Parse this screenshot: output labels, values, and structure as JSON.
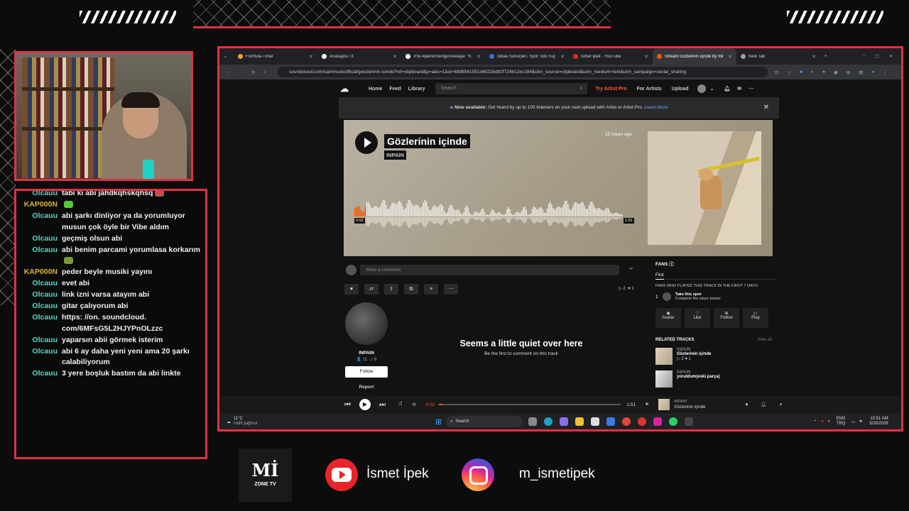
{
  "overlay": {
    "social": {
      "youtube": "İsmet İpek",
      "instagram": "m_ismetipek"
    },
    "logo": {
      "main": "Mİ",
      "sub": "ZONE TV"
    },
    "accent": "#e03145"
  },
  "chat": {
    "messages": [
      {
        "user": "Olcauu",
        "color": "#55d7c7",
        "text": "tabi ki abi jahdkqhskqhsq",
        "emote": true
      },
      {
        "user": "KAP000N",
        "color": "#66ff33",
        "text": "",
        "emote": true
      },
      {
        "user": "Olcauu",
        "color": "#55d7c7",
        "text": "abi şarkı dinliyor ya da yorumluyor musun çok öyle bir Vibe aldım",
        "emote": false
      },
      {
        "user": "Olcauu",
        "color": "#55d7c7",
        "text": "geçmiş olsun abi",
        "emote": false
      },
      {
        "user": "Olcauu",
        "color": "#55d7c7",
        "text": "abi benim parcami yorumlasa korkarım",
        "emote": true
      },
      {
        "user": "KAP000N",
        "color": "#66ff33",
        "text": "peder beyle musiki yayını",
        "emote": false
      },
      {
        "user": "Olcauu",
        "color": "#55d7c7",
        "text": "evet abi",
        "emote": false
      },
      {
        "user": "Olcauu",
        "color": "#55d7c7",
        "text": "link izni varsa atayım abi",
        "emote": false
      },
      {
        "user": "Olcauu",
        "color": "#55d7c7",
        "text": "gitar çalıyorum abi",
        "emote": false
      },
      {
        "user": "Olcauu",
        "color": "#55d7c7",
        "text": "https: //on. soundcloud. com/6MFsG5L2HJYPnOLzzc",
        "emote": false
      },
      {
        "user": "Olcauu",
        "color": "#55d7c7",
        "text": "yaparsın abii görmek isterim",
        "emote": false
      },
      {
        "user": "Olcauu",
        "color": "#55d7c7",
        "text": "abi 6 ay daha yeni yeni ama 20 şarkı calabiliyorum",
        "emote": false
      },
      {
        "user": "Olcauu",
        "color": "#55d7c7",
        "text": "3 yere boşluk bastım da abi linkte",
        "emote": false
      }
    ]
  },
  "browser": {
    "tabs": [
      {
        "label": "Formula-Timer",
        "color": "#f0a030",
        "active": false
      },
      {
        "label": "Anasayfa / X",
        "color": "#ffffff",
        "active": false
      },
      {
        "label": "X'te AlperenSengunAlwaya: \"Kar...",
        "color": "#ffffff",
        "active": false
      },
      {
        "label": "İddaa Sonuçları, Spor Toto Süper...",
        "color": "#3b6fd8",
        "active": false
      },
      {
        "label": "İsmet İpek - YouTube",
        "color": "#e8242a",
        "active": false
      },
      {
        "label": "Stream Gözlerinin içinde by INP...",
        "color": "#ff5500",
        "active": true
      },
      {
        "label": "New Tab",
        "color": "#9aa0a6",
        "active": false
      }
    ],
    "url": "soundcloud.com/sammusicoffical/goezlerinin-icinde?ref=clipboard&p=a&c=1&si=fdbf8541051d4022bd82f724b12ec164&utm_source=clipboard&utm_medium=text&utm_campaign=social_sharing"
  },
  "soundcloud": {
    "nav": {
      "home": "Home",
      "feed": "Feed",
      "library": "Library",
      "search_placeholder": "Search",
      "try_pro": "Try Artist Pro",
      "for_artists": "For Artists",
      "upload": "Upload"
    },
    "banner": {
      "bold": "Now available:",
      "text": "Get heard by up to 100 listeners on your next upload with Artist or Artist Pro.",
      "link": "Learn More"
    },
    "track": {
      "title": "Gözlerinin içinde",
      "artist": "INPAIN",
      "posted": "15 hours ago",
      "elapsed": "0:02",
      "duration": "1:51",
      "progress": 0.02,
      "hero_color": "#aaa290"
    },
    "comment_placeholder": "Write a comment",
    "stats": {
      "plays": "2",
      "likes": "1"
    },
    "artist_card": {
      "name": "INPAIN",
      "followers": "11",
      "tracks": "9",
      "follow": "Follow",
      "report": "Report"
    },
    "empty": {
      "title": "Seems a little quiet over here",
      "subtitle": "Be the first to comment on this track"
    },
    "fans": {
      "title": "FANS",
      "tab": "First",
      "note": "FANS WHO PLAYED THIS TRACK IN THE FIRST 7 DAYS:",
      "rank": "1",
      "take": "Take this spot",
      "steps": "Complete the steps below:",
      "actions": [
        "Avatar",
        "Like",
        "Follow",
        "Play"
      ]
    },
    "related": {
      "title": "RELATED TRACKS",
      "view_all": "View all",
      "items": [
        {
          "artist": "INPAIN",
          "title": "Gözlerinin içinde",
          "plays": "2",
          "likes": "1"
        },
        {
          "artist": "INPAIN",
          "title": "yoruldum(eski parça)",
          "plays": "",
          "likes": ""
        }
      ]
    },
    "player": {
      "elapsed": "0:02",
      "duration": "1:51",
      "artist": "INPAIN",
      "title": "Gözlerinin içinde"
    }
  },
  "taskbar": {
    "weather": "11°C",
    "weather_sub": "Hafif yağmur",
    "search": "Search",
    "lang": "ENG",
    "lang2": "TRQ",
    "time": "10:51 AM",
    "date": "3/28/2026"
  }
}
